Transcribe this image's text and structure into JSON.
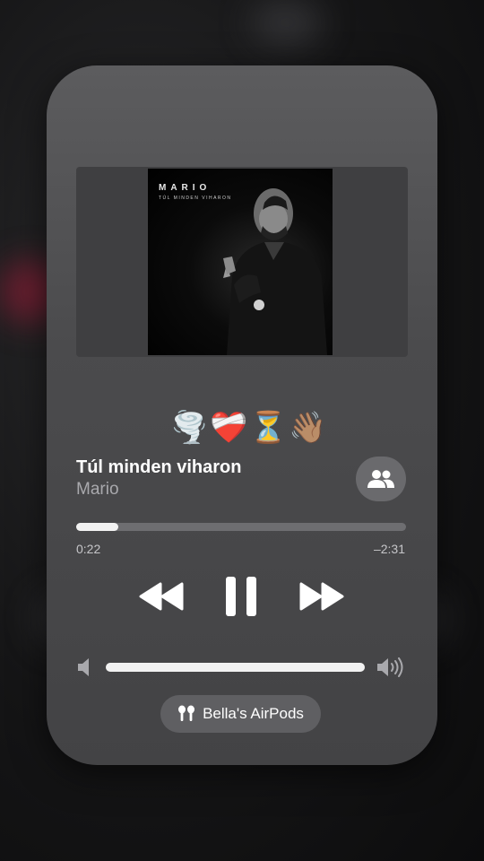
{
  "now_playing": {
    "artwork": {
      "artist_text": "MARIO",
      "album_text": "TÚL MINDEN VIHARON"
    },
    "reaction_emojis": [
      "🌪️",
      "❤️‍🩹",
      "⏳",
      "👋🏽"
    ],
    "track_title": "Túl minden viharon",
    "artist": "Mario",
    "progress": {
      "elapsed": "0:22",
      "remaining": "–2:31",
      "fraction": 0.127
    },
    "volume": {
      "fraction": 1.0
    },
    "output_device": {
      "label": "Bella's AirPods",
      "icon": "airpods-icon"
    },
    "controls": {
      "rewind_icon": "rewind-icon",
      "pause_icon": "pause-icon",
      "forward_icon": "forward-icon",
      "shareplay_icon": "shareplay-icon"
    },
    "colors": {
      "card": "#4b4b4d",
      "accent": "#f2f2f2",
      "secondary_text": "#a9a9ad"
    }
  }
}
